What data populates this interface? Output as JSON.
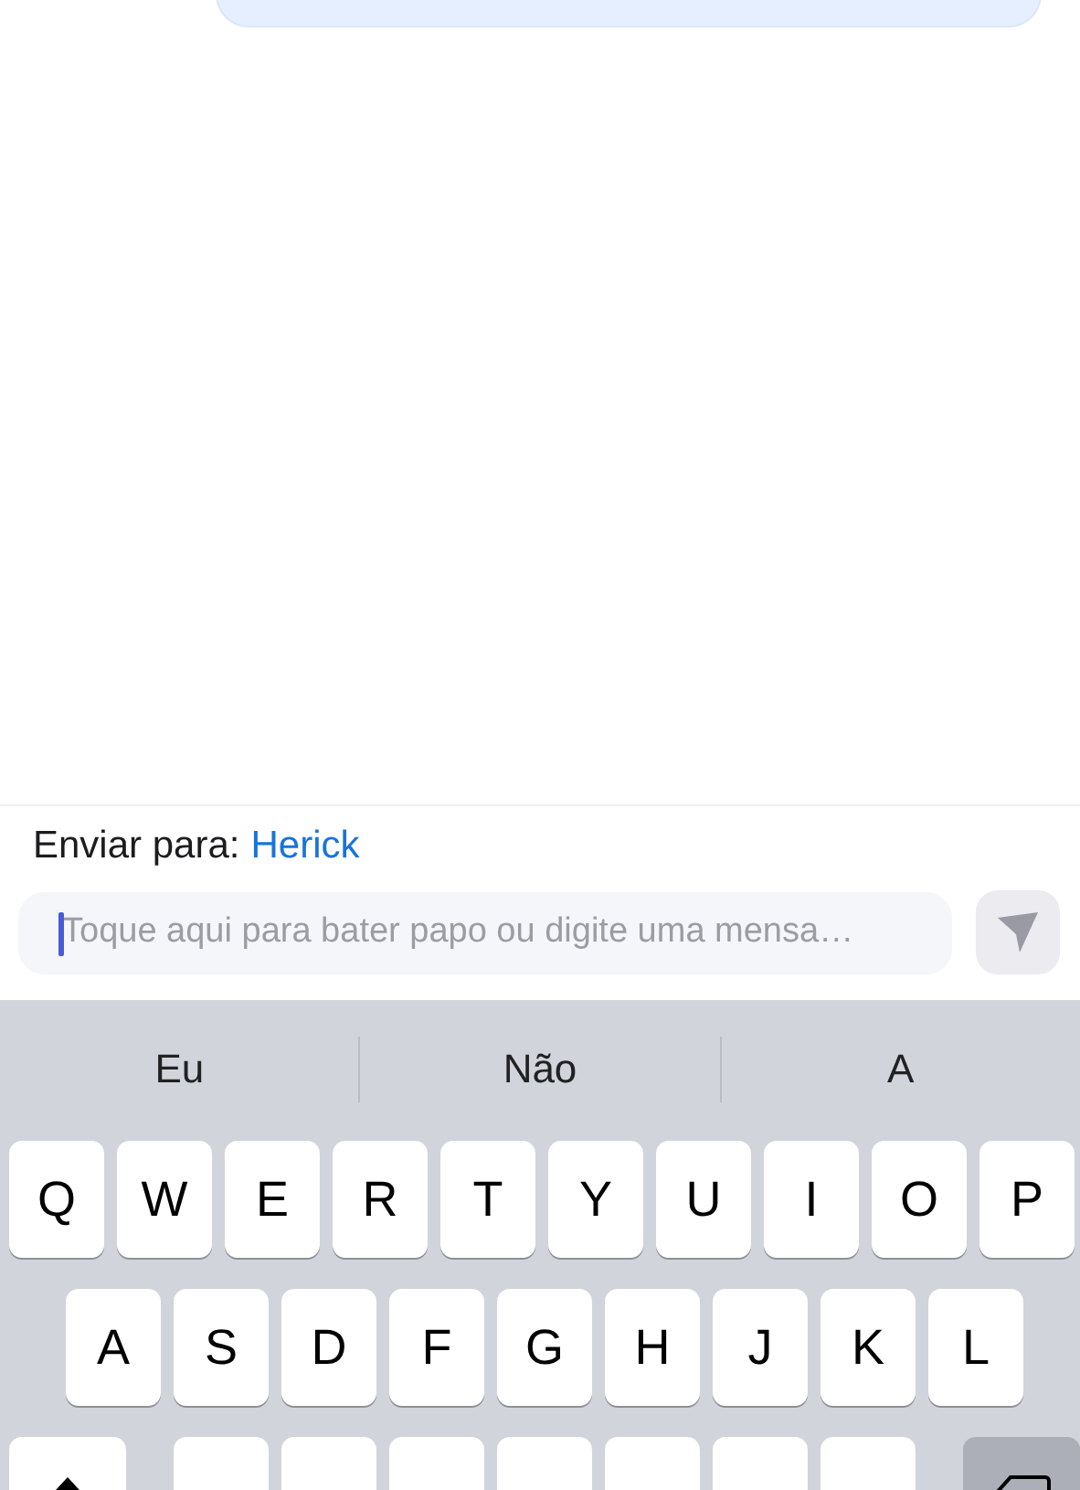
{
  "recipient": {
    "label": "Enviar para:",
    "name": "Herick"
  },
  "composer": {
    "placeholder": "Toque aqui para bater papo ou digite uma mensa…",
    "focused": true
  },
  "suggestions": [
    "Eu",
    "Não",
    "A"
  ],
  "keyboard": {
    "rows": [
      [
        "Q",
        "W",
        "E",
        "R",
        "T",
        "Y",
        "U",
        "I",
        "O",
        "P"
      ],
      [
        "A",
        "S",
        "D",
        "F",
        "G",
        "H",
        "J",
        "K",
        "L"
      ]
    ]
  }
}
